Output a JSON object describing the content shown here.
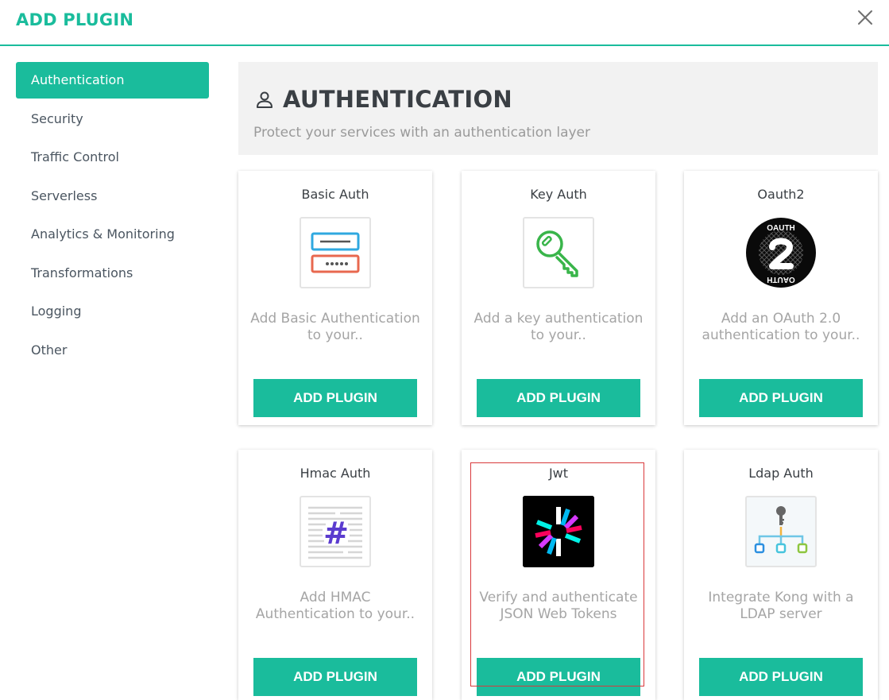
{
  "modal": {
    "title": "ADD PLUGIN"
  },
  "sidebar": {
    "items": [
      {
        "label": "Authentication",
        "active": true
      },
      {
        "label": "Security"
      },
      {
        "label": "Traffic Control"
      },
      {
        "label": "Serverless"
      },
      {
        "label": "Analytics & Monitoring"
      },
      {
        "label": "Transformations"
      },
      {
        "label": "Logging"
      },
      {
        "label": "Other"
      }
    ]
  },
  "section": {
    "title": "AUTHENTICATION",
    "subtitle": "Protect your services with an authentication layer",
    "icon": "user-icon"
  },
  "plugins": [
    {
      "name": "Basic Auth",
      "description": "Add Basic Authentication to your..",
      "button": "ADD PLUGIN",
      "icon": "basic-auth-form-icon"
    },
    {
      "name": "Key Auth",
      "description": "Add a key authentication to your..",
      "button": "ADD PLUGIN",
      "icon": "key-icon"
    },
    {
      "name": "Oauth2",
      "description": "Add an OAuth 2.0 authentication to your..",
      "button": "ADD PLUGIN",
      "icon": "oauth2-logo-icon",
      "logo_text": "OAUTH"
    },
    {
      "name": "Hmac Auth",
      "description": "Add HMAC Authentication to your..",
      "button": "ADD PLUGIN",
      "icon": "hash-document-icon"
    },
    {
      "name": "Jwt",
      "description": "Verify and authenticate JSON Web Tokens",
      "button": "ADD PLUGIN",
      "icon": "jwt-logo-icon"
    },
    {
      "name": "Ldap Auth",
      "description": "Integrate Kong with a LDAP server",
      "button": "ADD PLUGIN",
      "icon": "ldap-tree-icon"
    }
  ],
  "colors": {
    "accent": "#1abc9c",
    "text": "#3a3f44",
    "muted": "#a5a5a5",
    "highlight": "#d9393c"
  }
}
